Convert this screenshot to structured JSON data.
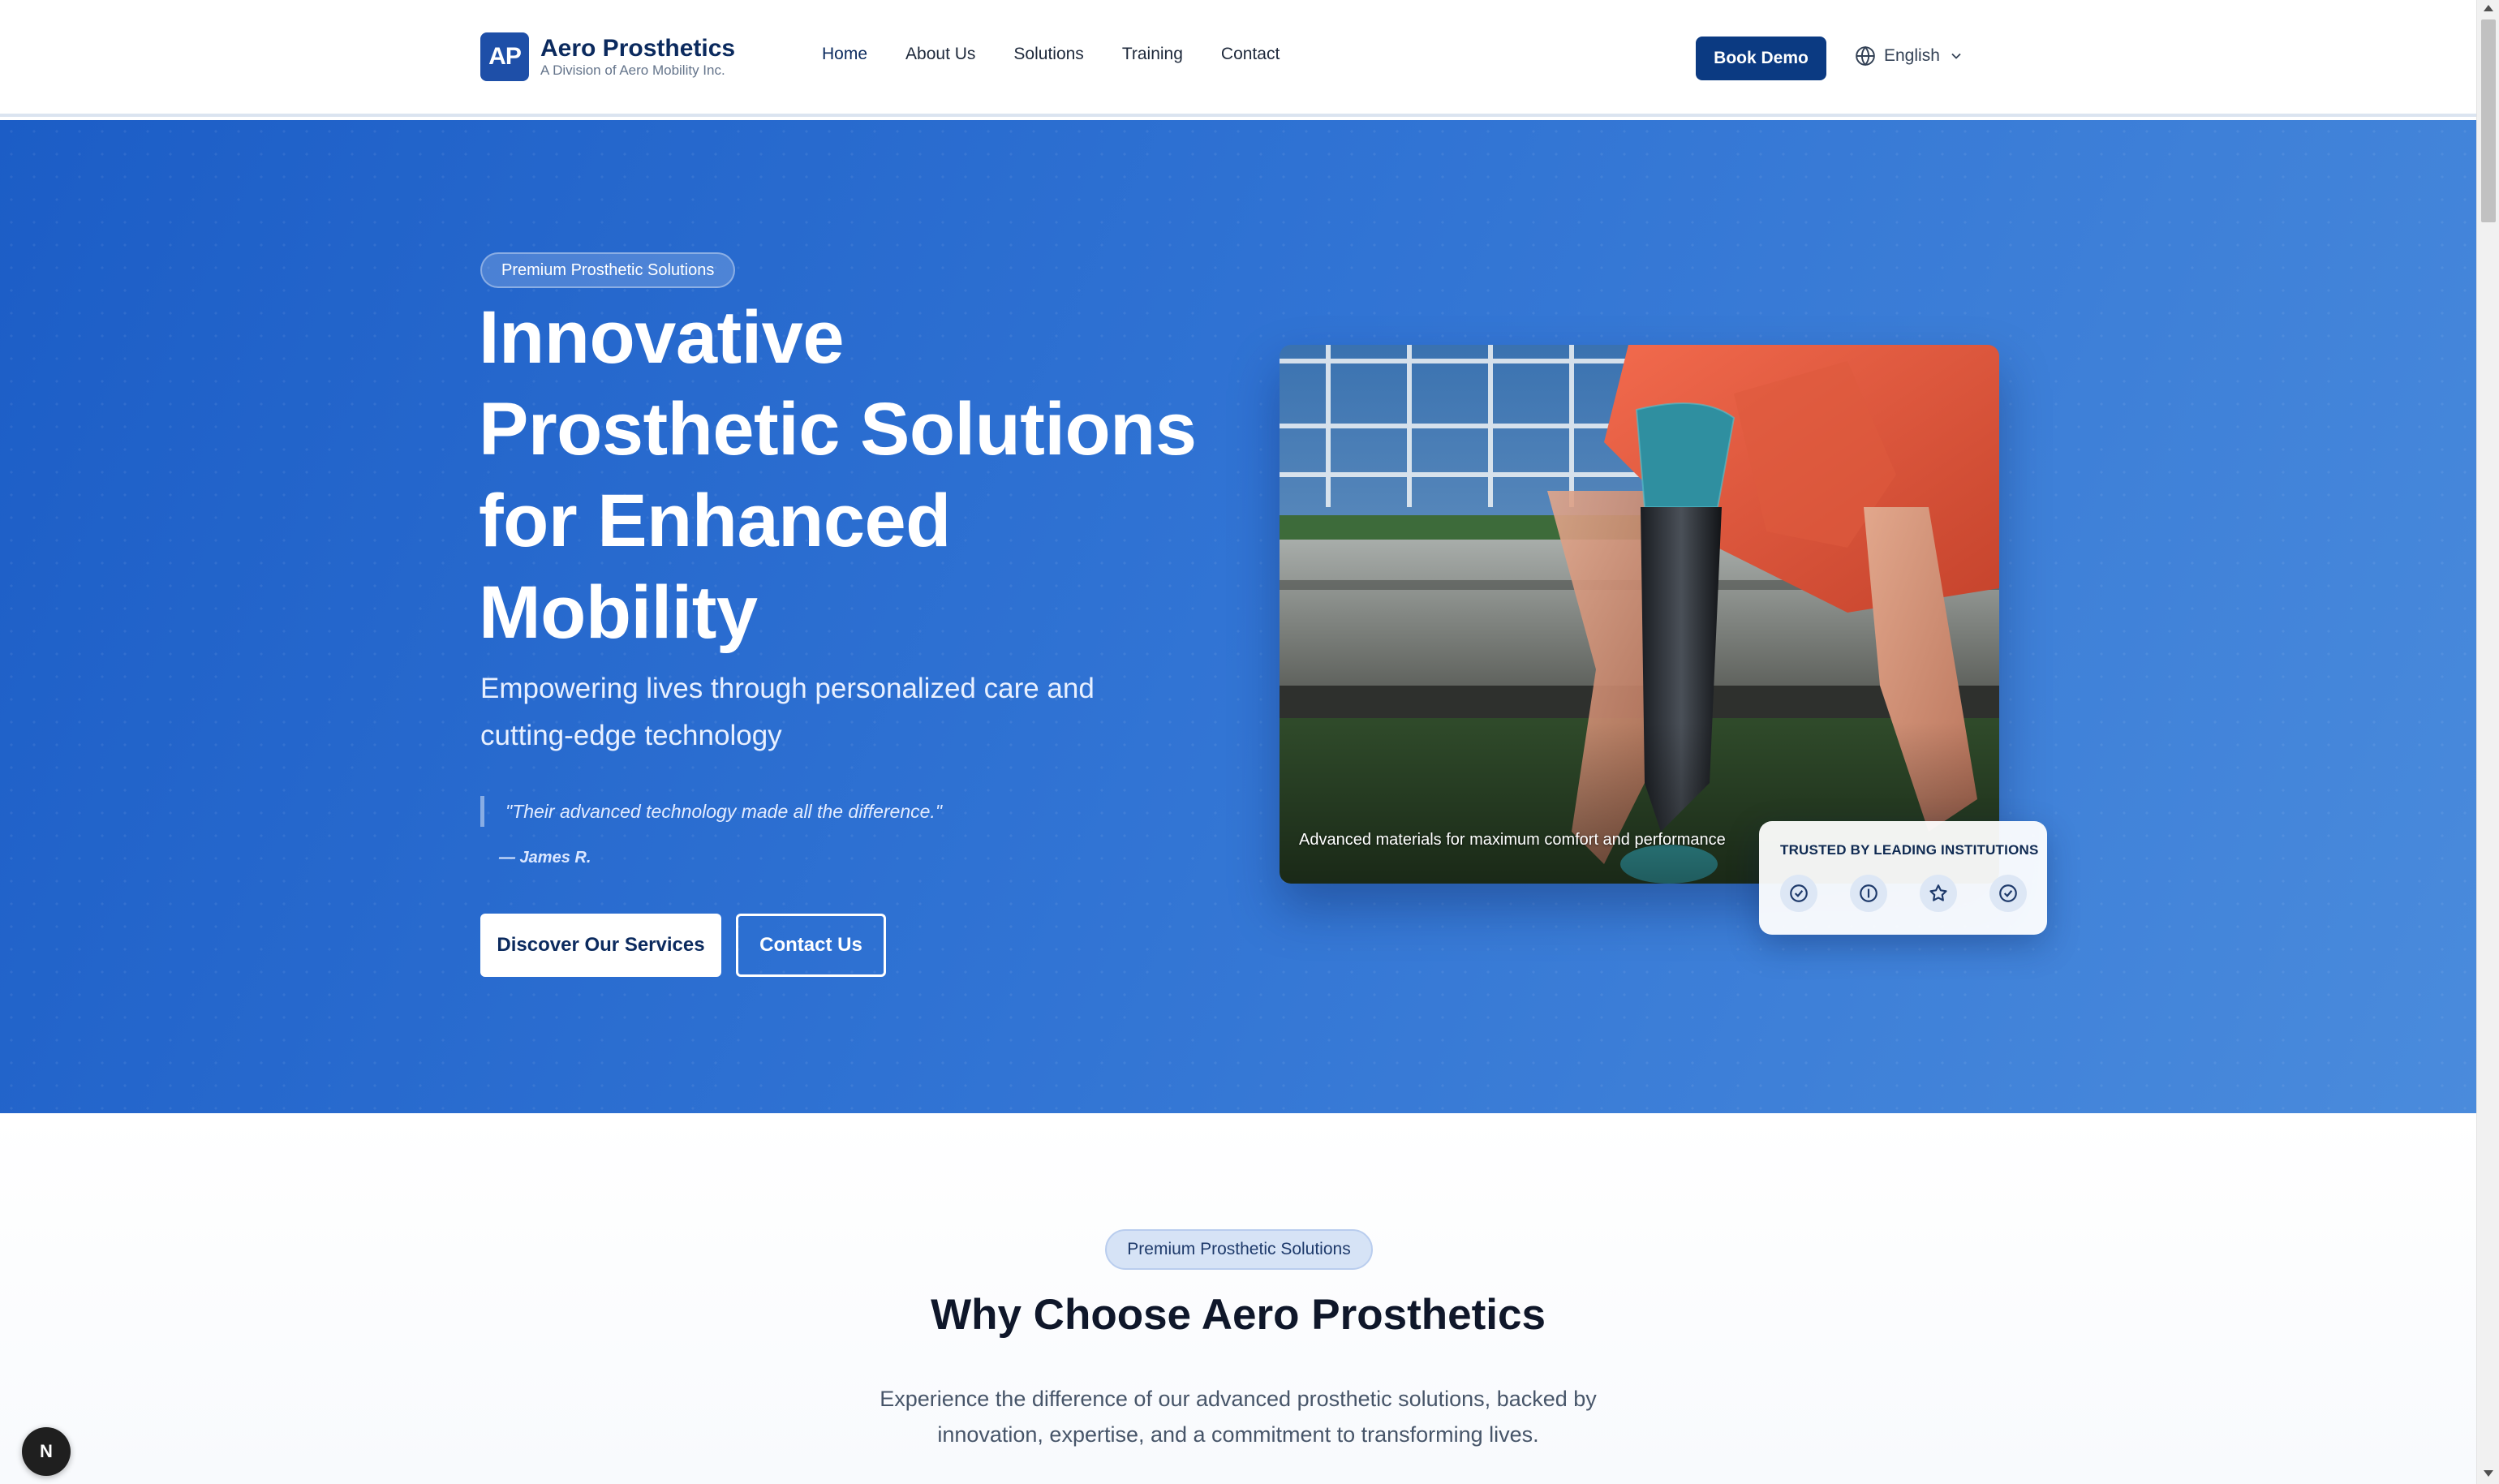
{
  "brand": {
    "mark": "AP",
    "name": "Aero Prosthetics",
    "tagline": "A Division of Aero Mobility Inc."
  },
  "nav": {
    "items": [
      {
        "label": "Home"
      },
      {
        "label": "About Us"
      },
      {
        "label": "Solutions"
      },
      {
        "label": "Training"
      },
      {
        "label": "Contact"
      }
    ],
    "active": "Home"
  },
  "header": {
    "book_demo": "Book Demo",
    "language": "English"
  },
  "hero": {
    "badge": "Premium Prosthetic Solutions",
    "title": "Innovative Prosthetic Solutions for Enhanced Mobility",
    "subtitle": "Empowering lives through personalized care and cutting-edge technology",
    "quote": "\"Their advanced technology made all the difference.\"",
    "quote_author": "— James R.",
    "primary_button": "Discover Our Services",
    "secondary_button": "Contact Us",
    "image_caption": "Advanced materials for maximum comfort and performance",
    "trust_title": "TRUSTED BY LEADING INSTITUTIONS",
    "trust_icons": [
      "check-circle-icon",
      "info-circle-icon",
      "star-icon",
      "check-circle-icon"
    ]
  },
  "why": {
    "badge": "Premium Prosthetic Solutions",
    "title": "Why Choose Aero Prosthetics",
    "description": "Experience the difference of our advanced prosthetic solutions, backed by innovation, expertise, and a commitment to transforming lives."
  },
  "dev_badge": "N",
  "colors": {
    "brand": "#0b3a82",
    "hero_start": "#1c5dc6",
    "hero_end": "#4a8bdc"
  }
}
